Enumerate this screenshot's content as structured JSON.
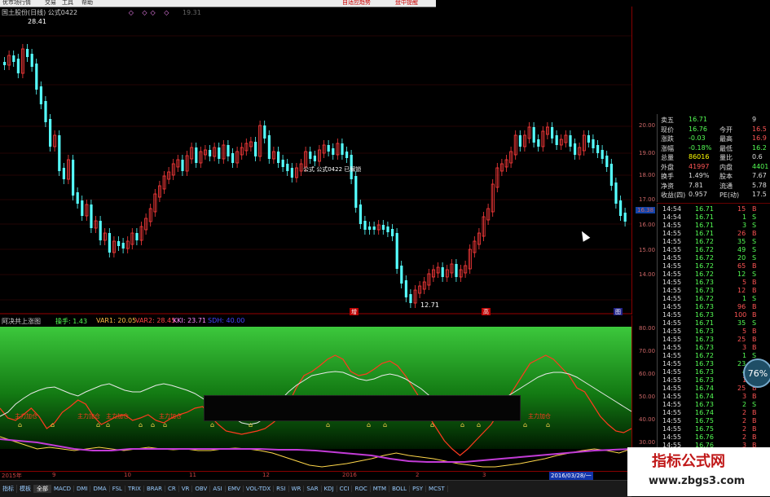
{
  "topbar": {
    "items": [
      "优市场行情",
      "交易",
      "工具",
      "帮助"
    ],
    "alert": "自适应趋势",
    "notice": "盘中提醒"
  },
  "main_chart": {
    "title_text": "国土股份(日线)  公式0422",
    "title_right": "19.31",
    "high_label": "28.41",
    "low_label": "12.71",
    "formula_label": "公式 公式0422 已解锁",
    "marker_left": "增",
    "marker_mid": "高",
    "marker_right": "图",
    "price_axis": [
      "20.00",
      "19.00",
      "18.00",
      "17.00",
      "16.00",
      "15.00",
      "14.00"
    ],
    "price_tag": "16.38"
  },
  "indicator": {
    "name": "阿决共上涨图",
    "params": [
      {
        "label": "操手: 1.43",
        "color": "#5f5"
      },
      {
        "label": "VAR1: 20.05",
        "color": "#fb4"
      },
      {
        "label": "VAR2: 28.45",
        "color": "#f44"
      },
      {
        "label": "KKI: 23.71",
        "color": "#f8f"
      },
      {
        "label": "SDH: 40.00",
        "color": "#44f"
      }
    ],
    "axis": [
      "80.00",
      "70.00",
      "60.00",
      "50.00",
      "40.00",
      "30.00"
    ],
    "signal_labels": [
      "主力加仓",
      "主力加仓",
      "主力加仓",
      "主力加仓",
      "主力加仓",
      "主力加仓"
    ]
  },
  "date_axis": {
    "labels": [
      "2015年",
      "9",
      "10",
      "11",
      "12",
      "2016",
      "2",
      "3"
    ],
    "current": "2016/03/28/一"
  },
  "tabs": [
    "指标",
    "模板",
    "全部",
    "MACD",
    "DMI",
    "DMA",
    "FSL",
    "TRIX",
    "BRAR",
    "CR",
    "VR",
    "OBV",
    "ASI",
    "EMV",
    "VOL-TDX",
    "RSI",
    "WR",
    "SAR",
    "KDJ",
    "CCI",
    "ROC",
    "MTM",
    "BOLL",
    "PSY",
    "MCST"
  ],
  "quote": {
    "rows": [
      {
        "l1": "卖五",
        "v1": "16.71",
        "l2": "",
        "v2": "9",
        "c1": "#5f5",
        "c2": "#ddd"
      },
      {
        "l1": "现价",
        "v1": "16.76",
        "l2": "今开",
        "v2": "16.5",
        "c1": "#5f5",
        "c2": "#f55"
      },
      {
        "l1": "涨跌",
        "v1": "-0.03",
        "l2": "最高",
        "v2": "16.9",
        "c1": "#5f5",
        "c2": "#f55"
      },
      {
        "l1": "涨幅",
        "v1": "-0.18%",
        "l2": "最低",
        "v2": "16.2",
        "c1": "#5f5",
        "c2": "#5f5"
      },
      {
        "l1": "总量",
        "v1": "86016",
        "l2": "量比",
        "v2": "0.6",
        "c1": "#ff0",
        "c2": "#ddd"
      },
      {
        "l1": "外盘",
        "v1": "41997",
        "l2": "内盘",
        "v2": "4401",
        "c1": "#f55",
        "c2": "#5f5"
      },
      {
        "l1": "换手",
        "v1": "1.49%",
        "l2": "股本",
        "v2": "7.67",
        "c1": "#ddd",
        "c2": "#ddd"
      },
      {
        "l1": "净资",
        "v1": "7.81",
        "l2": "流通",
        "v2": "5.78",
        "c1": "#ddd",
        "c2": "#ddd"
      },
      {
        "l1": "收益(四)",
        "v1": "0.957",
        "l2": "PE(动)",
        "v2": "17.5",
        "c1": "#ddd",
        "c2": "#ddd"
      }
    ]
  },
  "ticks": [
    {
      "t": "14:54",
      "p": "16.71",
      "v": "15",
      "s": "B"
    },
    {
      "t": "14:54",
      "p": "16.71",
      "v": "1",
      "s": "S"
    },
    {
      "t": "14:55",
      "p": "16.71",
      "v": "3",
      "s": "S"
    },
    {
      "t": "14:55",
      "p": "16.71",
      "v": "26",
      "s": "B"
    },
    {
      "t": "14:55",
      "p": "16.72",
      "v": "35",
      "s": "S"
    },
    {
      "t": "14:55",
      "p": "16.72",
      "v": "49",
      "s": "S"
    },
    {
      "t": "14:55",
      "p": "16.72",
      "v": "20",
      "s": "S"
    },
    {
      "t": "14:55",
      "p": "16.72",
      "v": "65",
      "s": "B"
    },
    {
      "t": "14:55",
      "p": "16.72",
      "v": "12",
      "s": "S"
    },
    {
      "t": "14:55",
      "p": "16.73",
      "v": "5",
      "s": "B"
    },
    {
      "t": "14:55",
      "p": "16.73",
      "v": "12",
      "s": "B"
    },
    {
      "t": "14:55",
      "p": "16.72",
      "v": "1",
      "s": "S"
    },
    {
      "t": "14:55",
      "p": "16.73",
      "v": "96",
      "s": "B"
    },
    {
      "t": "14:55",
      "p": "16.73",
      "v": "100",
      "s": "B"
    },
    {
      "t": "14:55",
      "p": "16.71",
      "v": "35",
      "s": "S"
    },
    {
      "t": "14:55",
      "p": "16.73",
      "v": "5",
      "s": "B"
    },
    {
      "t": "14:55",
      "p": "16.73",
      "v": "25",
      "s": "B"
    },
    {
      "t": "14:55",
      "p": "16.73",
      "v": "3",
      "s": "B"
    },
    {
      "t": "14:55",
      "p": "16.72",
      "v": "1",
      "s": "S"
    },
    {
      "t": "14:55",
      "p": "16.73",
      "v": "23",
      "s": "S"
    },
    {
      "t": "14:55",
      "p": "16.73",
      "v": "4",
      "s": "S"
    },
    {
      "t": "14:55",
      "p": "16.73",
      "v": "1",
      "s": "B"
    },
    {
      "t": "14:55",
      "p": "16.74",
      "v": "25",
      "s": "B"
    },
    {
      "t": "14:55",
      "p": "16.74",
      "v": "3",
      "s": "B"
    },
    {
      "t": "14:55",
      "p": "16.73",
      "v": "2",
      "s": "S"
    },
    {
      "t": "14:55",
      "p": "16.74",
      "v": "2",
      "s": "B"
    },
    {
      "t": "14:55",
      "p": "16.75",
      "v": "2",
      "s": "B"
    },
    {
      "t": "14:55",
      "p": "16.75",
      "v": "2",
      "s": "B"
    },
    {
      "t": "14:55",
      "p": "16.76",
      "v": "2",
      "s": "B"
    },
    {
      "t": "14:55",
      "p": "16.76",
      "v": "3",
      "s": "B"
    }
  ],
  "badge": {
    "label": "76%"
  },
  "watermark": {
    "line1": "指标公式网",
    "line2": "www.zbgs3.com"
  },
  "colors": {
    "up": "#ff3b3b",
    "down": "#5ff",
    "bg": "#000",
    "green_grad_top": "#3cc83c",
    "green_grad_bottom": "#001a00"
  }
}
